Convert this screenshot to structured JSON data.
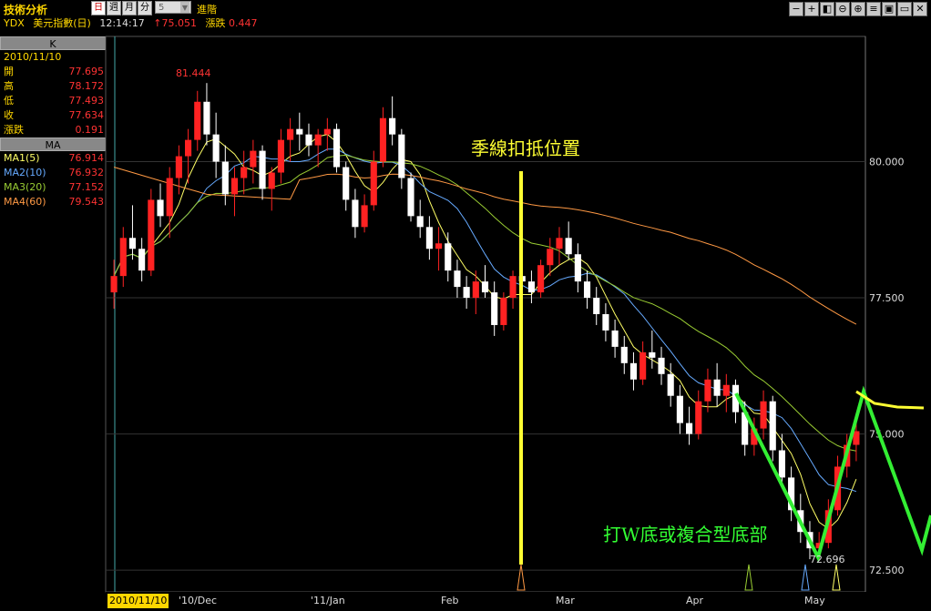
{
  "header": {
    "title": "技術分析",
    "periods": [
      "日",
      "週",
      "月",
      "分"
    ],
    "period_count": "5",
    "advanced": "進階",
    "symbol": "YDX",
    "name": "美元指數(日)",
    "time": "12:14:17",
    "price": "↑75.051",
    "change_label": "漲跌",
    "change_value": "0.447"
  },
  "toolbar": [
    "−",
    "+",
    "◧",
    "⊖",
    "⊕",
    "≡",
    "▣",
    "▭",
    "✕"
  ],
  "sidebar": {
    "k_header": "K",
    "date": "2010/11/10",
    "quotes": [
      {
        "label": "開",
        "value": "77.695"
      },
      {
        "label": "高",
        "value": "78.172"
      },
      {
        "label": "低",
        "value": "77.493"
      },
      {
        "label": "收",
        "value": "77.634"
      },
      {
        "label": "漲跌",
        "value": "0.191"
      }
    ],
    "ma_header": "MA",
    "ma": [
      {
        "label": "MA1(5)",
        "value": "76.914",
        "color": "#ffff66"
      },
      {
        "label": "MA2(10)",
        "value": "76.932",
        "color": "#66aaff"
      },
      {
        "label": "MA3(20)",
        "value": "77.152",
        "color": "#99cc33"
      },
      {
        "label": "MA4(60)",
        "value": "79.543",
        "color": "#ff9944"
      }
    ]
  },
  "annotations": {
    "quarter_line": "季線扣抵位置",
    "w_bottom": "打W底或複合型底部",
    "high_label": "81.444",
    "low_label": "72.696"
  },
  "bottom": {
    "date": "2010/11/10",
    "x_labels": [
      "'10/Dec",
      "'11/Jan",
      "Feb",
      "Mar",
      "Apr",
      "May"
    ]
  },
  "chart_data": {
    "type": "candlestick",
    "y_ticks": [
      "80.000",
      "77.500",
      "75.000",
      "72.500"
    ],
    "ylim": [
      72.1,
      82.3
    ],
    "x_labels": [
      "'10/Dec",
      "'11/Jan",
      "Feb",
      "Mar",
      "Apr",
      "May"
    ],
    "high": 81.444,
    "low": 72.696,
    "candles": [
      [
        77.6,
        78.2,
        77.3,
        77.9
      ],
      [
        77.9,
        78.8,
        77.7,
        78.6
      ],
      [
        78.6,
        79.2,
        78.2,
        78.4
      ],
      [
        78.4,
        78.6,
        77.8,
        78.0
      ],
      [
        78.0,
        79.5,
        77.9,
        79.3
      ],
      [
        79.3,
        79.6,
        78.8,
        79.0
      ],
      [
        79.0,
        79.9,
        78.6,
        79.7
      ],
      [
        79.7,
        80.3,
        79.4,
        80.1
      ],
      [
        80.1,
        80.6,
        79.6,
        80.4
      ],
      [
        80.4,
        81.3,
        80.2,
        81.1
      ],
      [
        81.1,
        81.444,
        80.3,
        80.5
      ],
      [
        80.5,
        80.9,
        79.7,
        80.0
      ],
      [
        80.0,
        80.3,
        79.2,
        79.4
      ],
      [
        79.4,
        79.9,
        79.0,
        79.7
      ],
      [
        79.7,
        80.2,
        79.4,
        79.9
      ],
      [
        79.9,
        80.4,
        79.6,
        80.2
      ],
      [
        80.2,
        80.3,
        79.3,
        79.5
      ],
      [
        79.5,
        79.9,
        79.1,
        79.8
      ],
      [
        79.8,
        80.6,
        79.6,
        80.4
      ],
      [
        80.4,
        80.8,
        80.0,
        80.6
      ],
      [
        80.6,
        80.9,
        80.2,
        80.5
      ],
      [
        80.5,
        80.7,
        80.1,
        80.3
      ],
      [
        80.3,
        80.6,
        79.9,
        80.5
      ],
      [
        80.5,
        80.8,
        80.2,
        80.6
      ],
      [
        80.6,
        80.7,
        79.8,
        79.9
      ],
      [
        79.9,
        80.0,
        79.1,
        79.3
      ],
      [
        79.3,
        79.5,
        78.6,
        78.8
      ],
      [
        78.8,
        79.4,
        78.7,
        79.2
      ],
      [
        79.2,
        80.2,
        79.1,
        80.0
      ],
      [
        80.0,
        81.0,
        79.9,
        80.8
      ],
      [
        80.8,
        81.2,
        80.3,
        80.5
      ],
      [
        80.5,
        80.6,
        79.5,
        79.7
      ],
      [
        79.7,
        79.8,
        78.9,
        79.0
      ],
      [
        79.0,
        79.3,
        78.6,
        78.8
      ],
      [
        78.8,
        79.0,
        78.2,
        78.4
      ],
      [
        78.4,
        78.8,
        78.0,
        78.5
      ],
      [
        78.5,
        78.7,
        77.8,
        78.0
      ],
      [
        78.0,
        78.2,
        77.5,
        77.7
      ],
      [
        77.7,
        77.9,
        77.3,
        77.5
      ],
      [
        77.5,
        78.0,
        77.2,
        77.8
      ],
      [
        77.8,
        78.1,
        77.5,
        77.6
      ],
      [
        77.6,
        77.8,
        76.8,
        77.0
      ],
      [
        77.0,
        77.6,
        76.9,
        77.5
      ],
      [
        77.5,
        78.0,
        77.3,
        77.9
      ],
      [
        77.9,
        78.3,
        77.6,
        77.8
      ],
      [
        77.8,
        78.0,
        77.4,
        77.6
      ],
      [
        77.6,
        78.2,
        77.5,
        78.1
      ],
      [
        78.1,
        78.6,
        77.9,
        78.4
      ],
      [
        78.4,
        78.8,
        78.1,
        78.6
      ],
      [
        78.6,
        78.9,
        78.2,
        78.3
      ],
      [
        78.3,
        78.5,
        77.6,
        77.8
      ],
      [
        77.8,
        78.0,
        77.3,
        77.5
      ],
      [
        77.5,
        77.7,
        77.0,
        77.2
      ],
      [
        77.2,
        77.4,
        76.7,
        76.9
      ],
      [
        76.9,
        77.1,
        76.4,
        76.6
      ],
      [
        76.6,
        76.8,
        76.1,
        76.3
      ],
      [
        76.3,
        76.5,
        75.8,
        76.0
      ],
      [
        76.0,
        76.7,
        75.9,
        76.5
      ],
      [
        76.5,
        76.9,
        76.2,
        76.4
      ],
      [
        76.4,
        76.6,
        75.9,
        76.1
      ],
      [
        76.1,
        76.3,
        75.5,
        75.7
      ],
      [
        75.7,
        75.9,
        75.0,
        75.2
      ],
      [
        75.2,
        75.5,
        74.8,
        75.0
      ],
      [
        75.0,
        75.8,
        74.9,
        75.6
      ],
      [
        75.6,
        76.2,
        75.4,
        76.0
      ],
      [
        76.0,
        76.3,
        75.5,
        75.7
      ],
      [
        75.7,
        76.1,
        75.4,
        75.9
      ],
      [
        75.9,
        76.0,
        75.2,
        75.4
      ],
      [
        75.4,
        75.6,
        74.6,
        74.8
      ],
      [
        74.8,
        75.3,
        74.6,
        75.1
      ],
      [
        75.1,
        75.8,
        74.9,
        75.6
      ],
      [
        75.6,
        75.7,
        74.5,
        74.7
      ],
      [
        74.7,
        75.0,
        74.0,
        74.2
      ],
      [
        74.2,
        74.4,
        73.4,
        73.6
      ],
      [
        73.6,
        73.9,
        73.0,
        73.2
      ],
      [
        73.2,
        73.4,
        72.7,
        72.9
      ],
      [
        72.9,
        73.2,
        72.696,
        73.0
      ],
      [
        73.0,
        73.8,
        72.9,
        73.6
      ],
      [
        73.6,
        74.6,
        73.5,
        74.4
      ],
      [
        74.4,
        75.0,
        74.2,
        74.8
      ],
      [
        74.8,
        75.2,
        74.5,
        75.051
      ]
    ]
  }
}
